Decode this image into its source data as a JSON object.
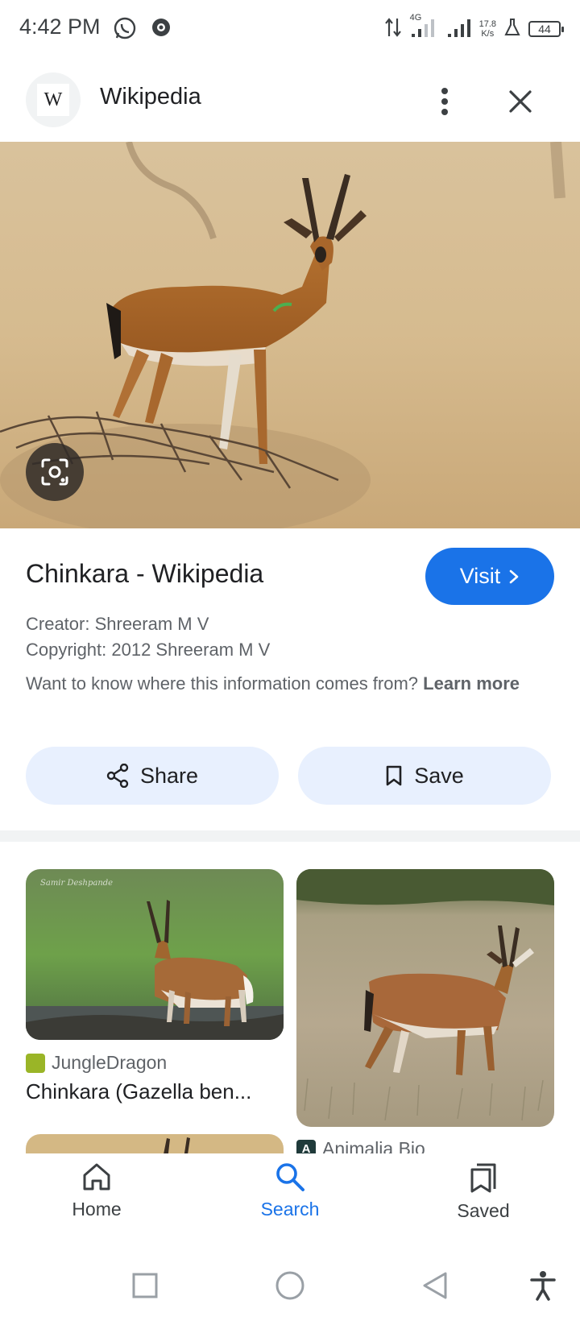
{
  "status_bar": {
    "time": "4:42 PM",
    "network_type": "4G",
    "speed_value": "17.8",
    "speed_unit": "K/s",
    "battery": "44"
  },
  "header": {
    "site_icon_letter": "W",
    "site_name": "Wikipedia",
    "more_icon": "more-vert-icon",
    "close_icon": "close-icon"
  },
  "result": {
    "title": "Chinkara - Wikipedia",
    "visit_label": "Visit",
    "creator": "Creator: Shreeram M V",
    "copyright": "Copyright: 2012 Shreeram M V",
    "info_question": "Want to know where this information comes from?",
    "learn_more": "Learn more",
    "share_label": "Share",
    "save_label": "Save"
  },
  "related": [
    {
      "source": "JungleDragon",
      "source_badge": "",
      "title": "Chinkara (Gazella ben...",
      "watermark": "Samir Deshpande"
    },
    {
      "source": "Animalia Bio",
      "source_badge": "A",
      "title": ""
    }
  ],
  "bottom_nav": {
    "items": [
      {
        "label": "Home",
        "icon": "home-icon"
      },
      {
        "label": "Search",
        "icon": "search-icon",
        "active": true
      },
      {
        "label": "Saved",
        "icon": "saved-collections-icon"
      }
    ]
  },
  "colors": {
    "accent": "#1a73e8",
    "pill_bg": "#e8f0fe",
    "muted_text": "#5f6368"
  }
}
